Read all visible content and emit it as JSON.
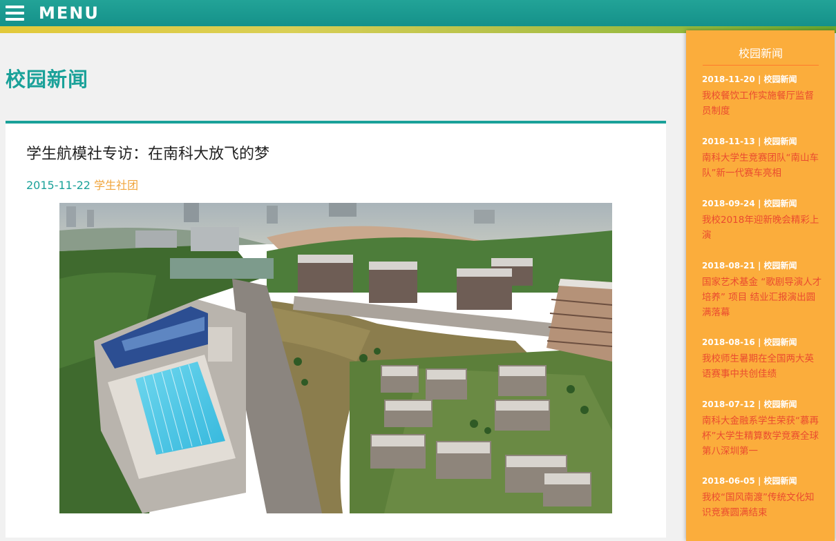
{
  "header": {
    "menu_label": "MENU"
  },
  "page": {
    "title": "校园新闻"
  },
  "article": {
    "title": "学生航模社专访：在南科大放飞的梦",
    "date": "2015-11-22",
    "category": "学生社团"
  },
  "sidebar": {
    "title": "校园新闻",
    "items": [
      {
        "date": "2018-11-20",
        "separator": "|",
        "category": "校园新闻",
        "title": "我校餐饮工作实施餐厅监督员制度"
      },
      {
        "date": "2018-11-13",
        "separator": "|",
        "category": "校园新闻",
        "title": "南科大学生竞赛团队“南山车队”新一代赛车亮相"
      },
      {
        "date": "2018-09-24",
        "separator": "|",
        "category": "校园新闻",
        "title": "我校2018年迎新晚会精彩上演"
      },
      {
        "date": "2018-08-21",
        "separator": "|",
        "category": "校园新闻",
        "title": "国家艺术基金 “歌剧导演人才培养” 项目 结业汇报演出圆满落幕"
      },
      {
        "date": "2018-08-16",
        "separator": "|",
        "category": "校园新闻",
        "title": "我校师生暑期在全国两大英语赛事中共创佳绩"
      },
      {
        "date": "2018-07-12",
        "separator": "|",
        "category": "校园新闻",
        "title": "南科大金融系学生荣获“慕再杯”大学生精算数学竞赛全球第八深圳第一"
      },
      {
        "date": "2018-06-05",
        "separator": "|",
        "category": "校园新闻",
        "title": "我校“国风南渡”传统文化知识竞赛圆满结束"
      }
    ]
  },
  "colors": {
    "teal": "#1aa199",
    "orange_sidebar": "#fbad3c",
    "link_red": "#ea4b2f",
    "category_orange": "#f0a43a"
  }
}
